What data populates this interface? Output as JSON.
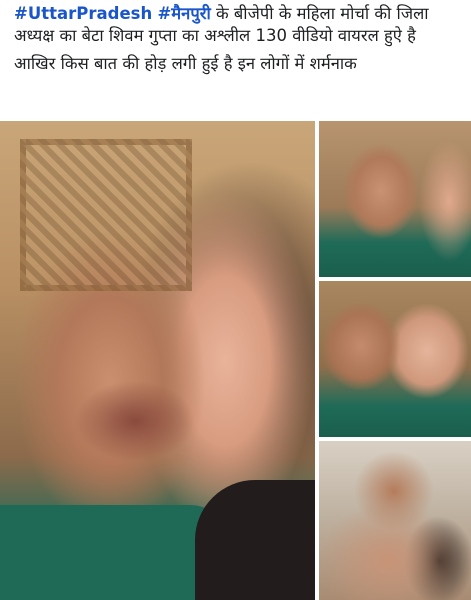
{
  "post": {
    "hashtags": [
      "#UttarPradesh",
      "#मैनपुरी"
    ],
    "line1_rest": " के बीजेपी के महिला मोर्चा की जिला अध्यक्ष का बेटा शिवम गुप्ता का अश्लील 130 वीडियो वायरल हुऐ है",
    "line2": "आखिर किस बात की होड़ लगी हुई है इन लोगों में शर्मनाक"
  },
  "photos": [
    {
      "alt": "photo-1"
    },
    {
      "alt": "photo-2"
    },
    {
      "alt": "photo-3"
    },
    {
      "alt": "photo-4"
    }
  ],
  "colors": {
    "hashtag": "#1a56c9",
    "text": "#1c1e21",
    "background": "#ffffff"
  }
}
